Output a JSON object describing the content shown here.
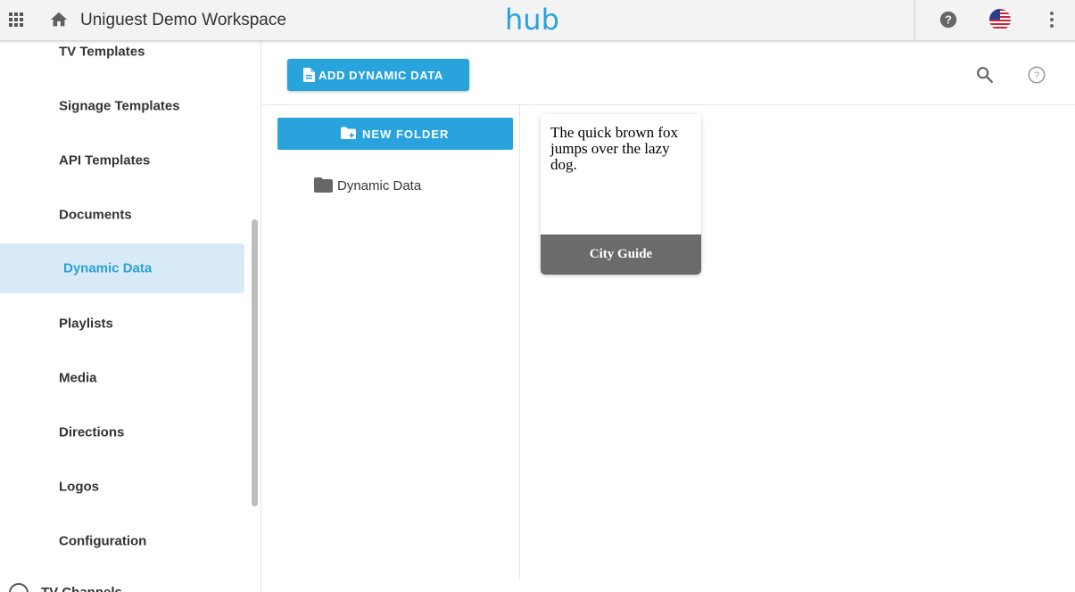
{
  "header": {
    "workspace_title": "Uniguest Demo Workspace",
    "logo_text": "hub",
    "icons": [
      "apps-grid-icon",
      "home-icon",
      "help-icon",
      "us-flag-icon",
      "more-vert-icon"
    ],
    "colors": {
      "brand_blue": "#29a3dc",
      "brand_yellow": "#f4b71c"
    }
  },
  "sidebar": {
    "items": [
      {
        "label": "TV Templates"
      },
      {
        "label": "Signage Templates"
      },
      {
        "label": "API Templates"
      },
      {
        "label": "Documents"
      },
      {
        "label": "Dynamic Data",
        "active": true
      },
      {
        "label": "Playlists"
      },
      {
        "label": "Media"
      },
      {
        "label": "Directions"
      },
      {
        "label": "Logos"
      },
      {
        "label": "Configuration"
      }
    ],
    "partial_item": "TV Channels",
    "active_color": "#2b9fd9"
  },
  "toolbar": {
    "add_label": "ADD DYNAMIC DATA",
    "icons": [
      "search-icon",
      "help-outline-icon"
    ]
  },
  "folders": {
    "new_folder_label": "NEW FOLDER",
    "items": [
      {
        "label": "Dynamic Data"
      }
    ]
  },
  "cards": [
    {
      "preview_text": "The quick brown fox jumps over the lazy dog.",
      "title": "City Guide"
    }
  ]
}
